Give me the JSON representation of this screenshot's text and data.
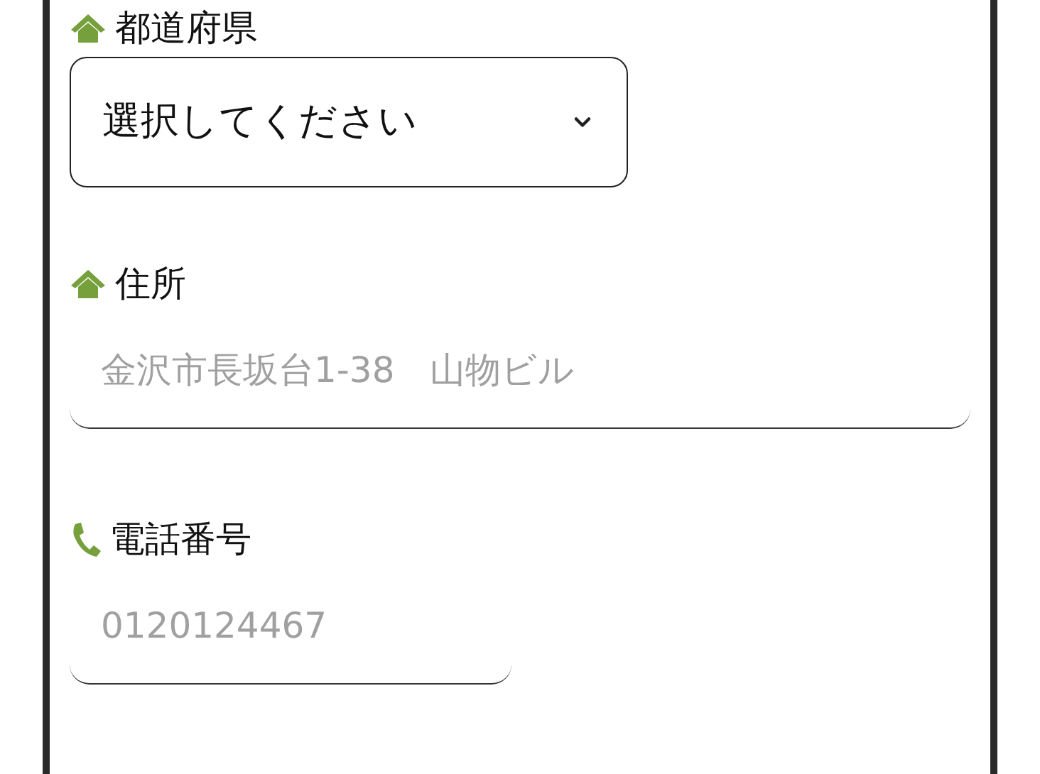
{
  "fields": [
    {
      "kind": "select",
      "label": "都道府県",
      "value": "選択してください"
    },
    {
      "kind": "address",
      "label": "住所",
      "placeholder": "金沢市長坂台1-38　山物ビル"
    },
    {
      "kind": "phone",
      "label": "電話番号",
      "placeholder": "0120124467"
    }
  ]
}
